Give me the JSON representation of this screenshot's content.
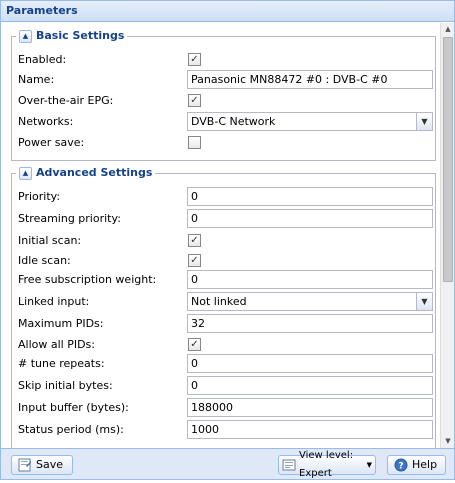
{
  "panel": {
    "title": "Parameters"
  },
  "basic": {
    "legend": "Basic Settings",
    "enabled": {
      "label": "Enabled:",
      "checked": true
    },
    "name": {
      "label": "Name:",
      "value": "Panasonic MN88472 #0 : DVB-C #0"
    },
    "ota_epg": {
      "label": "Over-the-air EPG:",
      "checked": true
    },
    "networks": {
      "label": "Networks:",
      "value": "DVB-C Network"
    },
    "power_save": {
      "label": "Power save:",
      "checked": false
    }
  },
  "advanced": {
    "legend": "Advanced Settings",
    "priority": {
      "label": "Priority:",
      "value": "0"
    },
    "streaming_priority": {
      "label": "Streaming priority:",
      "value": "0"
    },
    "initial_scan": {
      "label": "Initial scan:",
      "checked": true
    },
    "idle_scan": {
      "label": "Idle scan:",
      "checked": true
    },
    "free_sub_weight": {
      "label": "Free subscription weight:",
      "value": "0"
    },
    "linked_input": {
      "label": "Linked input:",
      "value": "Not linked"
    },
    "max_pids": {
      "label": "Maximum PIDs:",
      "value": "32"
    },
    "allow_all_pids": {
      "label": "Allow all PIDs:",
      "checked": true
    },
    "tune_repeats": {
      "label": "# tune repeats:",
      "value": "0"
    },
    "skip_initial_bytes": {
      "label": "Skip initial bytes:",
      "value": "0"
    },
    "input_buffer": {
      "label": "Input buffer (bytes):",
      "value": "188000"
    },
    "status_period": {
      "label": "Status period (ms):",
      "value": "1000"
    }
  },
  "footer": {
    "save_label": "Save",
    "view_level_label": "View level: Expert",
    "help_label": "Help"
  },
  "icons": {
    "check": "✓",
    "dropdown": "▼",
    "collapse": "▲",
    "scroll_up": "▲",
    "scroll_down": "▼"
  },
  "colors": {
    "header_text": "#15428b",
    "border": "#99bbe8",
    "footer_bg": "#dfe8f6"
  }
}
